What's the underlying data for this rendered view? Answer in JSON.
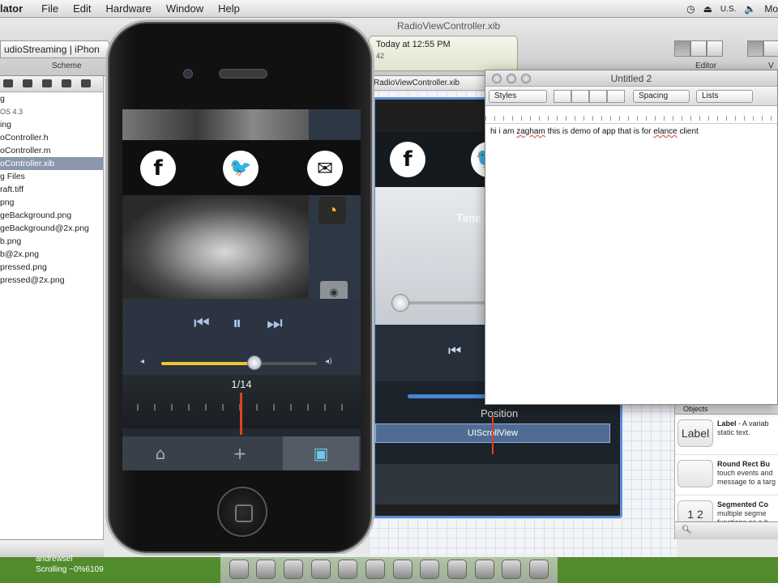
{
  "menubar": {
    "app": "lator",
    "items": [
      "File",
      "Edit",
      "Hardware",
      "Window",
      "Help"
    ],
    "right": {
      "locale": "U.S.",
      "user": "Mo"
    }
  },
  "xcode": {
    "window_title": "RadioViewController.xib",
    "scheme_text": "udioStreaming | iPhon",
    "scheme_label": "Scheme",
    "activity": "Today at 12:55 PM",
    "activity_sub": "42",
    "editor_label": "Editor",
    "view_label": "V",
    "jump_bar": "RadioViewController.xib"
  },
  "navigator": {
    "rows": [
      {
        "label": "g",
        "selected": false,
        "small": false
      },
      {
        "label": "OS 4.3",
        "selected": false,
        "small": true
      },
      {
        "label": "ing",
        "selected": false,
        "small": false
      },
      {
        "label": "oController.h",
        "selected": false,
        "small": false
      },
      {
        "label": "oController.m",
        "selected": false,
        "small": false
      },
      {
        "label": "oController.xib",
        "selected": true,
        "small": false
      },
      {
        "label": "g Files",
        "selected": false,
        "small": false
      },
      {
        "label": "raft.tiff",
        "selected": false,
        "small": false
      },
      {
        "label": "png",
        "selected": false,
        "small": false
      },
      {
        "label": "geBackground.png",
        "selected": false,
        "small": false
      },
      {
        "label": "geBackground@2x.png",
        "selected": false,
        "small": false
      },
      {
        "label": "b.png",
        "selected": false,
        "small": false
      },
      {
        "label": "b@2x.png",
        "selected": false,
        "small": false
      },
      {
        "label": "pressed.png",
        "selected": false,
        "small": false
      },
      {
        "label": "pressed@2x.png",
        "selected": false,
        "small": false
      }
    ]
  },
  "ib": {
    "position_label": "Position",
    "scroll_view_label": "UIScrollView",
    "art_text": "Time"
  },
  "simulator": {
    "share": {
      "facebook": "f",
      "twitter": "🐦",
      "email": "✉"
    },
    "rss_icon": "rss-icon",
    "transport": {
      "prev": "⏮",
      "pause": "⏸",
      "next": "⏭"
    },
    "volume": {
      "low_icon": "◂",
      "high_icon": "◂)",
      "level": 0.6
    },
    "dial_count": "1/14",
    "tabs": {
      "home": "⌂",
      "add": "+",
      "radio": "▣"
    }
  },
  "textedit": {
    "title": "Untitled 2",
    "styles": "Styles",
    "spacing": "Spacing",
    "lists": "Lists",
    "body_parts": [
      "hi i am ",
      "zagham",
      " this is demo of app that is for ",
      "elance",
      " client"
    ]
  },
  "library": {
    "header": "Objects",
    "items": [
      {
        "icon": "Label",
        "title": "Label",
        "suffix": " - A variab",
        "desc": "static text."
      },
      {
        "icon": "",
        "title": "Round Rect Bu",
        "suffix": "",
        "desc": "touch events and\nmessage to a targ"
      },
      {
        "icon": "1 2",
        "title": "Segmented Co",
        "suffix": "",
        "desc": "multiple segme\nfunctions as a b"
      }
    ],
    "search_icon": "search-icon"
  },
  "bottom": {
    "status_line1": "andrewsel",
    "status_line2": "Scrolling ~0%6109"
  },
  "colors": {
    "accent_blue": "#5b8fd8",
    "needle": "#e1421d",
    "volume_fill": "#f3c233",
    "tab_active": "#6fc9e6"
  }
}
